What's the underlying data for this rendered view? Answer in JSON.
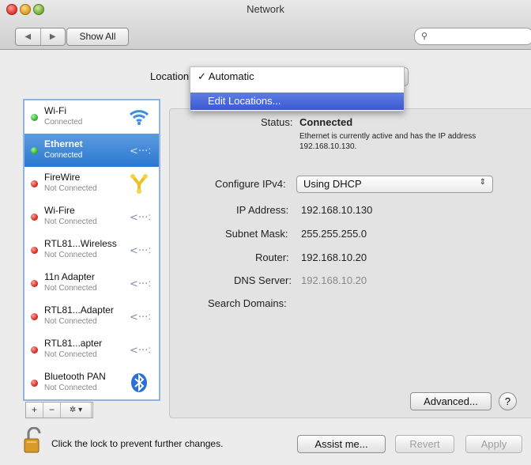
{
  "window": {
    "title": "Network"
  },
  "toolbar": {
    "back": "◀",
    "forward": "▶",
    "show_all": "Show All",
    "search_placeholder": ""
  },
  "location": {
    "label": "Location",
    "menu": [
      {
        "label": "✓ Automatic",
        "selected": true
      },
      {
        "label": "Edit Locations...",
        "highlighted": true
      }
    ]
  },
  "services": [
    {
      "name": "Wi-Fi",
      "status": "Connected",
      "state": "green",
      "icon": "wifi-icon"
    },
    {
      "name": "Ethernet",
      "status": "Connected",
      "state": "green",
      "icon": "ethernet-icon",
      "selected": true
    },
    {
      "name": "FireWire",
      "status": "Not Connected",
      "state": "red",
      "icon": "firewire-icon"
    },
    {
      "name": "Wi-Fire",
      "status": "Not Connected",
      "state": "red",
      "icon": "network-interface-icon"
    },
    {
      "name": "RTL81...Wireless",
      "status": "Not Connected",
      "state": "red",
      "icon": "network-interface-icon"
    },
    {
      "name": "11n Adapter",
      "status": "Not Connected",
      "state": "red",
      "icon": "network-interface-icon"
    },
    {
      "name": "RTL81...Adapter",
      "status": "Not Connected",
      "state": "red",
      "icon": "network-interface-icon"
    },
    {
      "name": "RTL81...apter",
      "status": "Not Connected",
      "state": "red",
      "icon": "network-interface-icon"
    },
    {
      "name": "Bluetooth PAN",
      "status": "Not Connected",
      "state": "red",
      "icon": "bluetooth-icon"
    }
  ],
  "sidebar_tools": {
    "add": "+",
    "remove": "−",
    "gear": "✲ ▾"
  },
  "details": {
    "status_label": "Status:",
    "status_value": "Connected",
    "status_desc": "Ethernet is currently active and has the IP address 192.168.10.130.",
    "configure_label": "Configure IPv4:",
    "configure_value": "Using DHCP",
    "ip_label": "IP Address:",
    "ip_value": "192.168.10.130",
    "subnet_label": "Subnet Mask:",
    "subnet_value": "255.255.255.0",
    "router_label": "Router:",
    "router_value": "192.168.10.20",
    "dns_label": "DNS Server:",
    "dns_value": "192.168.10.20",
    "search_label": "Search Domains:"
  },
  "buttons": {
    "advanced": "Advanced...",
    "help": "?",
    "assist": "Assist me...",
    "revert": "Revert",
    "apply": "Apply"
  },
  "lock": {
    "text": "Click the lock to prevent further changes."
  },
  "colors": {
    "selection": "#2c78d0",
    "menu_highlight": "#3a5ad5",
    "connected": "#27a827",
    "disconnected": "#d11d14"
  }
}
